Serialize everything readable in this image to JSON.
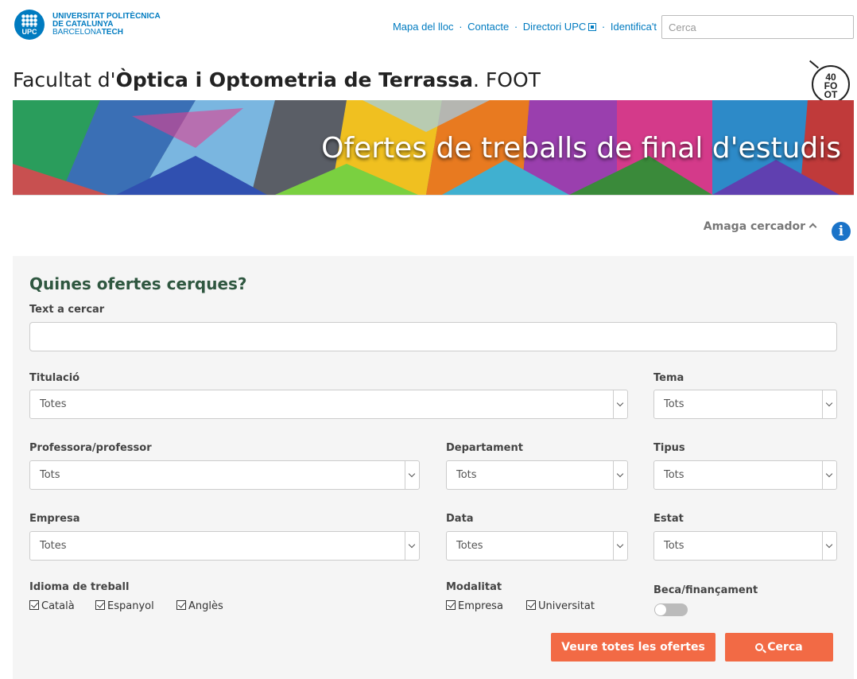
{
  "brand": {
    "logo_mark": "UPC",
    "line1": "UNIVERSITAT POLITÈCNICA",
    "line2": "DE CATALUNYA",
    "line3a": "BARCELONA",
    "line3b": "TECH"
  },
  "toplinks": {
    "map": "Mapa del lloc",
    "contact": "Contacte",
    "directory": "Directori UPC",
    "login": "Identifica't",
    "separator": "·"
  },
  "search": {
    "placeholder": "Cerca"
  },
  "faculty": {
    "prefix": "Facultat d'",
    "name": "Òptica i Optometria de Terrassa",
    "suffix": ". FOOT"
  },
  "badge": {
    "top": "40",
    "mid": "FO",
    "bot": "OT"
  },
  "banner": {
    "title": "Ofertes de treballs de final d'estudis"
  },
  "toggle": {
    "label": "Amaga cercador"
  },
  "info": {
    "icon": "i"
  },
  "form": {
    "heading": "Quines ofertes cerques?",
    "text_label": "Text a cercar",
    "titulacio": {
      "label": "Titulació",
      "value": "Totes"
    },
    "tema": {
      "label": "Tema",
      "value": "Tots"
    },
    "professor": {
      "label": "Professora/professor",
      "value": "Tots"
    },
    "departament": {
      "label": "Departament",
      "value": "Tots"
    },
    "tipus": {
      "label": "Tipus",
      "value": "Tots"
    },
    "empresa": {
      "label": "Empresa",
      "value": "Totes"
    },
    "data": {
      "label": "Data",
      "value": "Totes"
    },
    "estat": {
      "label": "Estat",
      "value": "Tots"
    },
    "idioma": {
      "label": "Idioma de treball",
      "options": [
        "Català",
        "Espanyol",
        "Anglès"
      ]
    },
    "modalitat": {
      "label": "Modalitat",
      "options": [
        "Empresa",
        "Universitat"
      ]
    },
    "beca": {
      "label": "Beca/finançament"
    },
    "btn_all": "Veure totes les ofertes",
    "btn_search": "Cerca"
  }
}
